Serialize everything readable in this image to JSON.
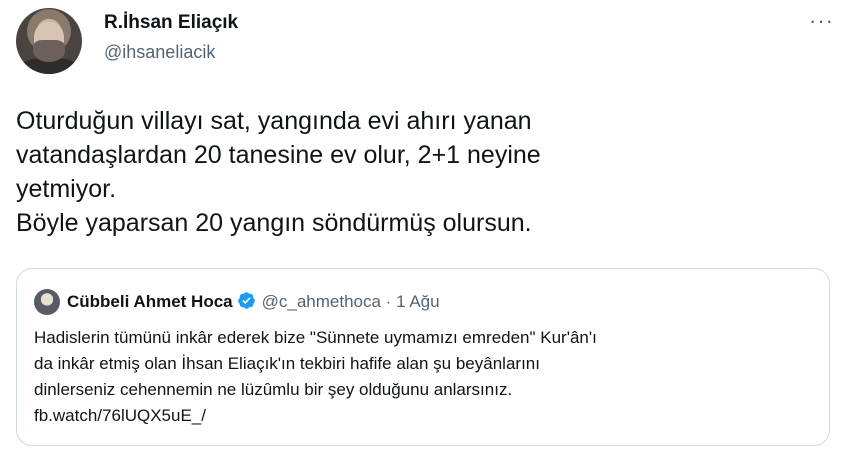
{
  "author": {
    "display_name": "R.İhsan Eliaçık",
    "handle": "@ihsaneliacik"
  },
  "menu": {
    "more_label": "···"
  },
  "tweet_text_lines": [
    "Oturduğun villayı sat, yangında evi ahırı yanan",
    "vatandaşlardan 20 tanesine ev olur, 2+1 neyine",
    "yetmiyor.",
    "Böyle yaparsan 20 yangın söndürmüş olursun."
  ],
  "quoted_tweet": {
    "display_name": "Cübbeli Ahmet Hoca",
    "verified": true,
    "handle": "@c_ahmethoca",
    "separator": "·",
    "date": "1 Ağu",
    "text_lines": [
      "Hadislerin tümünü inkâr ederek bize \"Sünnete uymamızı emreden\" Kur'ân'ı",
      "da inkâr etmiş olan İhsan Eliaçık'ın tekbiri hafife alan şu beyânlarını",
      "dinlerseniz cehennemin ne lüzûmlu bir şey olduğunu anlarsınız.",
      "fb.watch/76lUQX5uE_/"
    ]
  },
  "colors": {
    "text": "#0f1419",
    "secondary": "#536471",
    "border": "#cfd9de",
    "verified_blue": "#1d9bf0"
  }
}
